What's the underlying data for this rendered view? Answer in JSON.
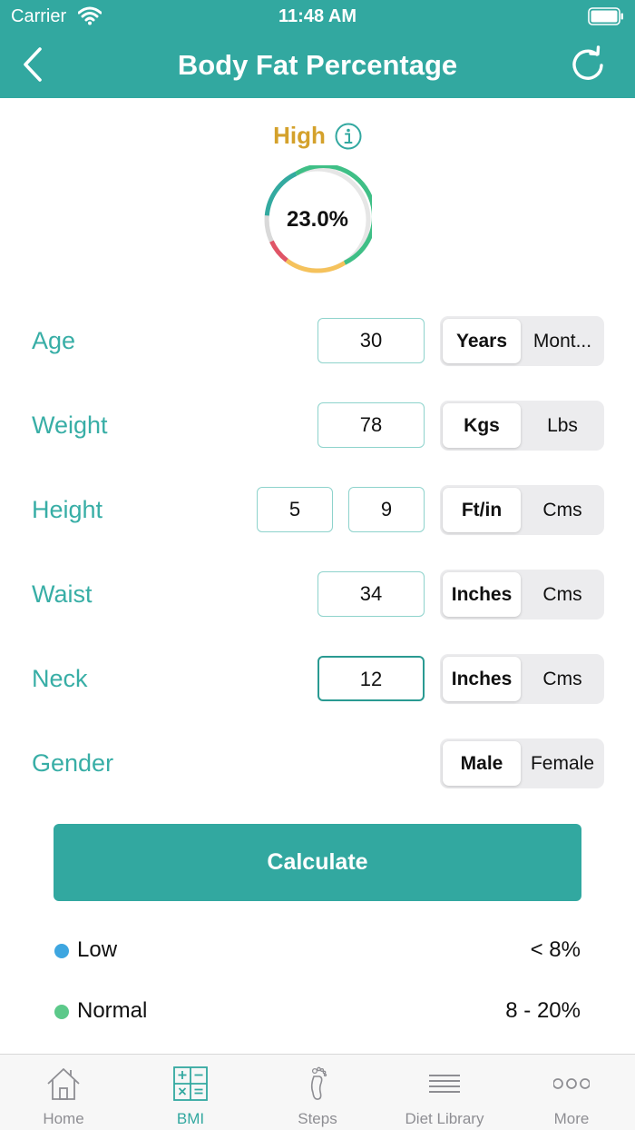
{
  "status_bar": {
    "carrier": "Carrier",
    "time": "11:48 AM"
  },
  "nav": {
    "title": "Body Fat Percentage"
  },
  "result": {
    "status": "High",
    "value": "23.0%",
    "status_color": "#d4a12b"
  },
  "form": {
    "age": {
      "label": "Age",
      "value": "30",
      "options": [
        "Years",
        "Mont..."
      ],
      "selected": 0
    },
    "weight": {
      "label": "Weight",
      "value": "78",
      "options": [
        "Kgs",
        "Lbs"
      ],
      "selected": 0
    },
    "height": {
      "label": "Height",
      "feet": "5",
      "inches": "9",
      "options": [
        "Ft/in",
        "Cms"
      ],
      "selected": 0
    },
    "waist": {
      "label": "Waist",
      "value": "34",
      "options": [
        "Inches",
        "Cms"
      ],
      "selected": 0
    },
    "neck": {
      "label": "Neck",
      "value": "12",
      "options": [
        "Inches",
        "Cms"
      ],
      "selected": 0
    },
    "gender": {
      "label": "Gender",
      "options": [
        "Male",
        "Female"
      ],
      "selected": 0
    }
  },
  "calculate_label": "Calculate",
  "legend": [
    {
      "name": "Low",
      "range": "< 8%",
      "color": "#3ea6e0"
    },
    {
      "name": "Normal",
      "range": "8 - 20%",
      "color": "#5cc98a"
    }
  ],
  "tabs": [
    {
      "label": "Home",
      "icon": "home-icon"
    },
    {
      "label": "BMI",
      "icon": "calculator-icon",
      "active": true
    },
    {
      "label": "Steps",
      "icon": "footprint-icon"
    },
    {
      "label": "Diet Library",
      "icon": "list-icon"
    },
    {
      "label": "More",
      "icon": "more-icon"
    }
  ],
  "colors": {
    "accent": "#32a8a0",
    "label_teal": "#38aea6",
    "tab_inactive": "#8e8e93"
  }
}
